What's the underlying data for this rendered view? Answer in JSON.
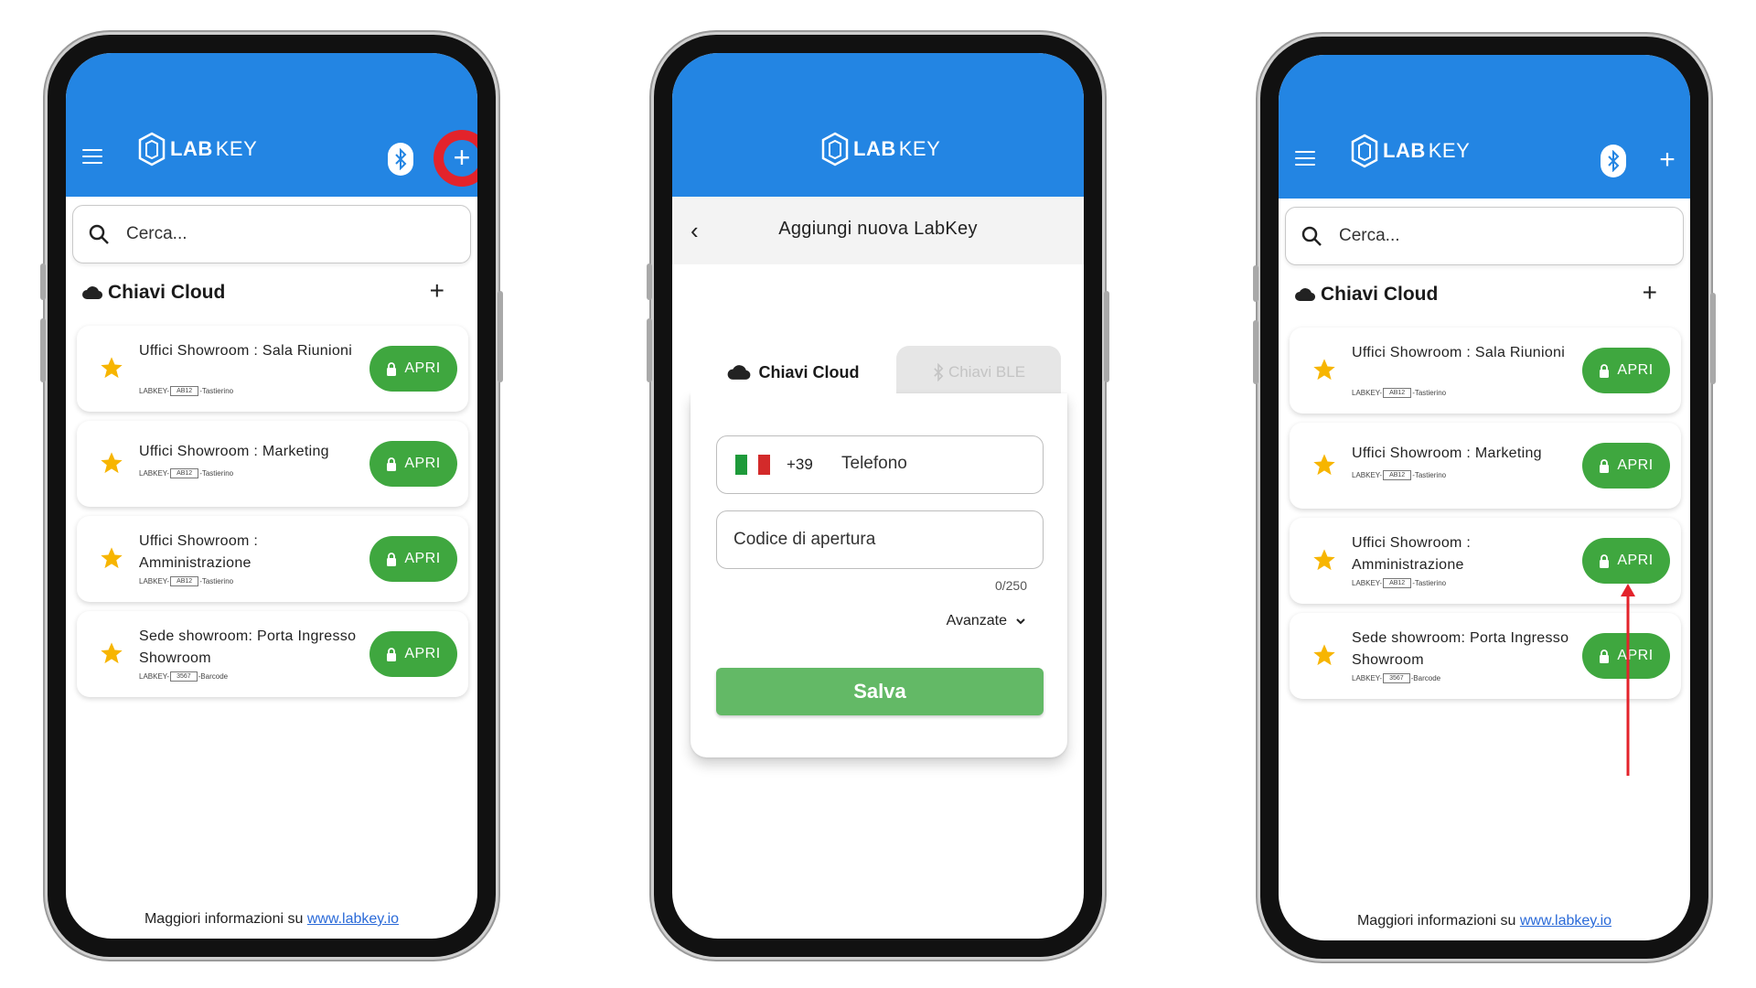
{
  "brand": {
    "lab": "LAB",
    "key": "KEY"
  },
  "colors": {
    "primary": "#2385e3",
    "success": "#3fa73f",
    "save": "#63b966",
    "highlight": "#e3232b",
    "arrow": "#e3232b"
  },
  "search": {
    "placeholder": "Cerca..."
  },
  "section": {
    "title": "Chiavi Cloud"
  },
  "keys": [
    {
      "title": "Uffici Showroom : Sala Riunioni",
      "prefix": "LABKEY-",
      "code": "AB12",
      "suffix": "-Tastierino",
      "button": "APRI"
    },
    {
      "title": "Uffici Showroom : Marketing",
      "prefix": "LABKEY-",
      "code": "AB12",
      "suffix": "-Tastierino",
      "button": "APRI"
    },
    {
      "title": "Uffici Showroom : Amministrazione",
      "prefix": "LABKEY-",
      "code": "AB12",
      "suffix": "-Tastierino",
      "button": "APRI"
    },
    {
      "title": "Sede showroom: Porta Ingresso Showroom",
      "prefix": "LABKEY-",
      "code": "3567",
      "suffix": "-Barcode",
      "button": "APRI"
    }
  ],
  "footer": {
    "text": "Maggiori informazioni su ",
    "link": "www.labkey.io"
  },
  "add_form": {
    "header": "Aggiungi nuova LabKey",
    "tabs": {
      "cloud": "Chiavi Cloud",
      "ble": "Chiavi BLE"
    },
    "phone": {
      "prefix": "+39",
      "label": "Telefono"
    },
    "code": {
      "label": "Codice di apertura",
      "counter": "0/250"
    },
    "advanced": "Avanzate",
    "save": "Salva"
  },
  "icons": [
    "menu-icon",
    "labkey-logo-icon",
    "bluetooth-icon",
    "plus-icon",
    "search-icon",
    "cloud-icon",
    "star-icon",
    "lock-icon",
    "back-icon",
    "chevron-down-icon",
    "italy-flag-icon"
  ]
}
